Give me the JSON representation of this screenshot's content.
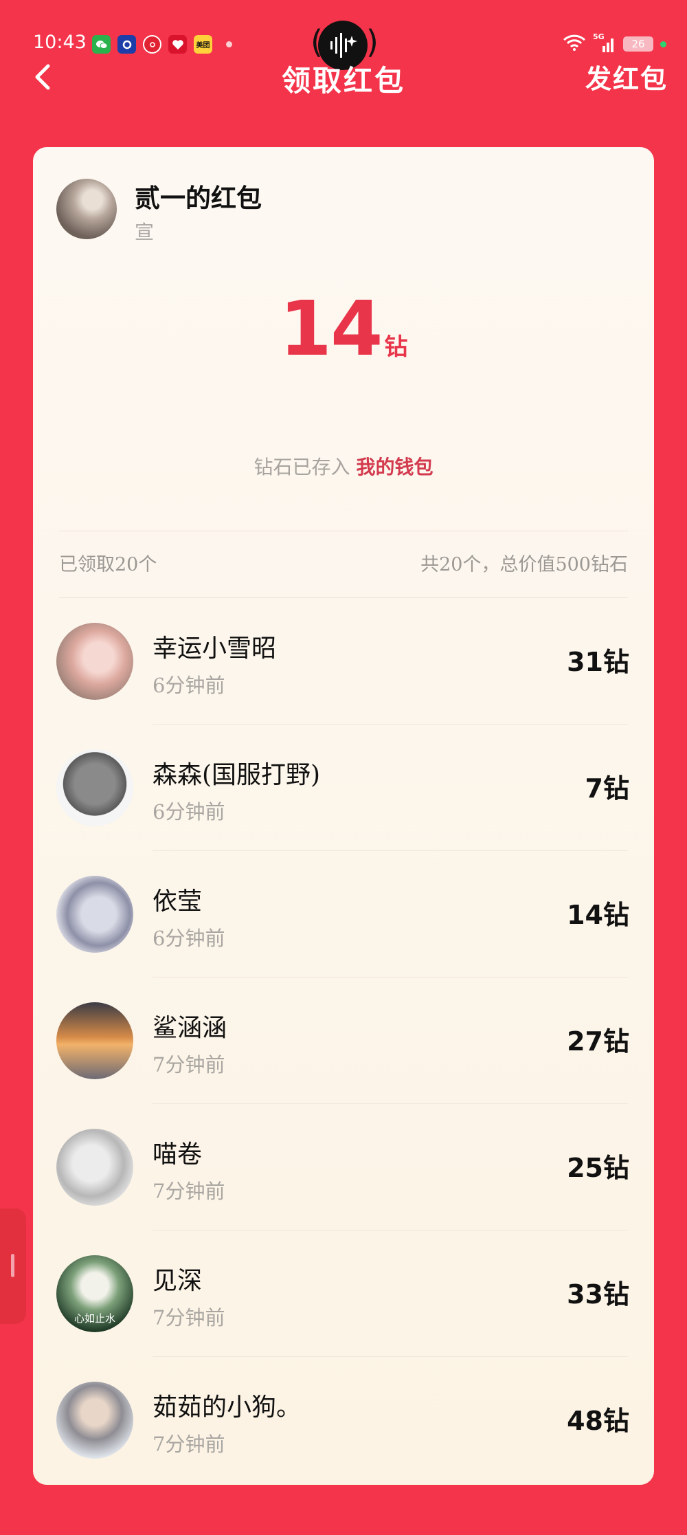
{
  "status_bar": {
    "time": "10:43",
    "network": "5G",
    "battery": "26",
    "notification_icons": [
      "wechat-icon",
      "app-icon",
      "netease-icon",
      "red-app-icon",
      "meituan-icon"
    ],
    "meituan_label": "美团"
  },
  "nav": {
    "title": "领取红包",
    "send_label": "发红包"
  },
  "card": {
    "sender_title": "贰一的红包",
    "sender_sub": "宣",
    "amount": "14",
    "amount_unit": "钻",
    "wallet_note": "钻石已存入",
    "wallet_link": "我的钱包",
    "claimed_summary": "已领取20个",
    "total_summary": "共20个，总价值500钻石"
  },
  "recipients": [
    {
      "name": "幸运小雪昭",
      "time": "6分钟前",
      "amount": "31钻"
    },
    {
      "name": "森森(国服打野)",
      "time": "6分钟前",
      "amount": "7钻"
    },
    {
      "name": "依莹",
      "time": "6分钟前",
      "amount": "14钻"
    },
    {
      "name": "鲨涵涵",
      "time": "7分钟前",
      "amount": "27钻"
    },
    {
      "name": "喵卷",
      "time": "7分钟前",
      "amount": "25钻"
    },
    {
      "name": "见深",
      "time": "7分钟前",
      "amount": "33钻",
      "avatar_text": "心如止水"
    },
    {
      "name": "茹茹的小狗。",
      "time": "7分钟前",
      "amount": "48钻"
    }
  ],
  "colors": {
    "background": "#f4344a",
    "accent": "#e8354a",
    "card": "#fdf8f2"
  }
}
